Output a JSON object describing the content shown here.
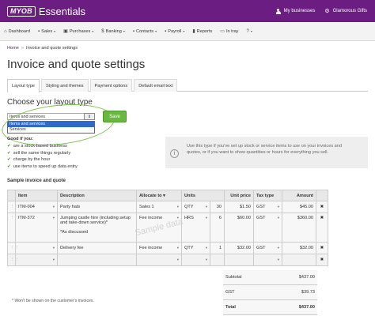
{
  "header": {
    "logo": "MYOB",
    "product": "Essentials",
    "my_businesses": "My businesses",
    "business_name": "Glamorous Gifts"
  },
  "nav": [
    {
      "label": "Dashboard",
      "icon": "home-icon",
      "glyph": "⌂",
      "caret": ""
    },
    {
      "label": "Sales",
      "icon": "sales-icon",
      "glyph": "▪",
      "caret": "▾"
    },
    {
      "label": "Purchases",
      "icon": "purchases-icon",
      "glyph": "▣",
      "caret": "▾"
    },
    {
      "label": "Banking",
      "icon": "banking-icon",
      "glyph": "$",
      "caret": "▾"
    },
    {
      "label": "Contacts",
      "icon": "contacts-icon",
      "glyph": "▪",
      "caret": "▾"
    },
    {
      "label": "Payroll",
      "icon": "payroll-icon",
      "glyph": "▪",
      "caret": "▾"
    },
    {
      "label": "Reports",
      "icon": "reports-icon",
      "glyph": "▮",
      "caret": ""
    },
    {
      "label": "In tray",
      "icon": "in-tray-icon",
      "glyph": "▭",
      "caret": ""
    },
    {
      "label": "",
      "icon": "help-icon",
      "glyph": "?",
      "caret": "▾"
    }
  ],
  "breadcrumb": {
    "home": "Home",
    "sep": "»",
    "current": "Invoice and quote settings"
  },
  "page_title": "Invoice and quote settings",
  "tabs": [
    {
      "label": "Layout type",
      "active": true
    },
    {
      "label": "Styling and themes",
      "active": false
    },
    {
      "label": "Payment options",
      "active": false
    },
    {
      "label": "Default email text",
      "active": false
    }
  ],
  "layout": {
    "heading": "Choose your layout type",
    "selected": "Items and services",
    "options": [
      "Items and services",
      "Services"
    ],
    "save_label": "Save"
  },
  "good_for": {
    "title": "Good if you:",
    "items": [
      "are a stock-based business",
      "sell the same things regularly",
      "charge by the hour",
      "use items to speed up data entry"
    ]
  },
  "info": {
    "text": "Use this type if you've set up stock or service items to use on your invoices and quotes, or if you want to show quantities or hours for everything you sell."
  },
  "sample": {
    "title": "Sample invoice and quote",
    "columns": [
      "Item",
      "Description",
      "Allocate to",
      "Units",
      "Unit price",
      "Tax type",
      "Amount"
    ],
    "allocate_marker": "*",
    "rows": [
      {
        "item": "ITM-004",
        "description": "Party hats",
        "allocate": "Sales 1",
        "units": "QTY",
        "qty": "30",
        "price": "$1.50",
        "tax": "GST",
        "amount": "$45.00"
      },
      {
        "item": "ITM-372",
        "description": "Jumping castle hire (including setup and take-down service)*",
        "note": "*As discussed",
        "allocate": "Fee income",
        "units": "HRS",
        "qty": "6",
        "price": "$60.00",
        "tax": "GST",
        "amount": "$360.00"
      },
      {
        "item": "",
        "description": "Delivery fee",
        "allocate": "Fee income",
        "units": "QTY",
        "qty": "1",
        "price": "$32.00",
        "tax": "GST",
        "amount": "$32.00"
      },
      {
        "item": "",
        "description": "",
        "allocate": "",
        "units": "",
        "qty": "",
        "price": "",
        "tax": "",
        "amount": ""
      }
    ],
    "watermark": "Sample data",
    "totals": [
      {
        "label": "Subtotal",
        "value": "$437.00"
      },
      {
        "label": "GST",
        "value": "$39.73"
      },
      {
        "label": "Total",
        "value": "$437.00"
      }
    ],
    "footnote": "* Won't be shown on the customer's invoices."
  },
  "colors": {
    "brand": "#6b1d82",
    "save": "#6ab83f",
    "highlight_ring": "#7cc24e",
    "selection": "#2f6ac9"
  }
}
